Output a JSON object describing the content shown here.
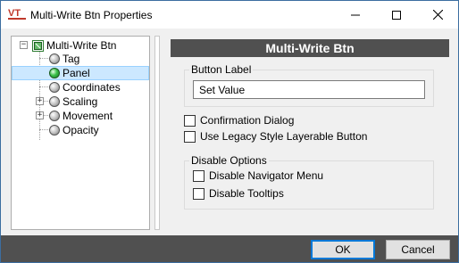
{
  "window": {
    "title": "Multi-Write Btn Properties",
    "logo_text": "VT",
    "accent": "#c0392b"
  },
  "tree": {
    "root": {
      "label": "Multi-Write Btn",
      "expander": "−"
    },
    "items": [
      {
        "label": "Tag",
        "icon": "grey-ball-icon"
      },
      {
        "label": "Panel",
        "icon": "green-ball-icon",
        "selected": true
      },
      {
        "label": "Coordinates",
        "icon": "grey-ball-icon"
      },
      {
        "label": "Scaling",
        "icon": "grey-ball-icon",
        "expander": "+"
      },
      {
        "label": "Movement",
        "icon": "grey-ball-icon",
        "expander": "+"
      },
      {
        "label": "Opacity",
        "icon": "grey-ball-icon"
      }
    ]
  },
  "panel": {
    "header": "Multi-Write Btn",
    "button_label_group": "Button Label",
    "button_label_value": "Set Value",
    "confirmation_dialog": "Confirmation Dialog",
    "legacy_style": "Use Legacy Style Layerable Button",
    "disable_options_group": "Disable Options",
    "disable_navigator_menu": "Disable Navigator Menu",
    "disable_tooltips": "Disable Tooltips"
  },
  "footer": {
    "ok_label": "OK",
    "cancel_label": "Cancel"
  }
}
